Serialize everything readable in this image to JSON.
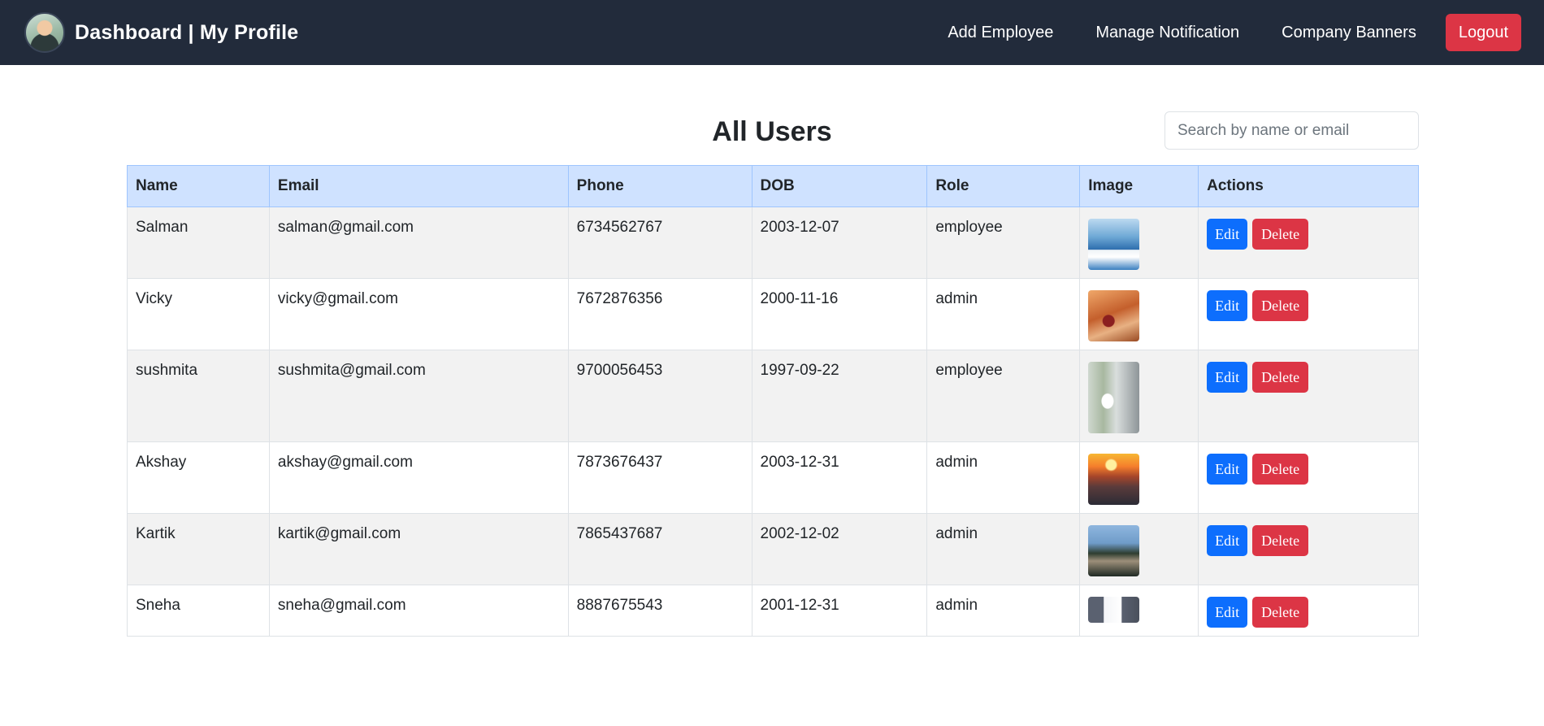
{
  "navbar": {
    "title": "Dashboard | My Profile",
    "links": [
      "Add Employee",
      "Manage Notification",
      "Company Banners"
    ],
    "logout_label": "Logout"
  },
  "page": {
    "title": "All Users",
    "search_placeholder": "Search by name or email"
  },
  "table": {
    "headers": [
      "Name",
      "Email",
      "Phone",
      "DOB",
      "Role",
      "Image",
      "Actions"
    ],
    "rows": [
      {
        "name": "Salman",
        "email": "salman@gmail.com",
        "phone": "6734562767",
        "dob": "2003-12-07",
        "role": "employee",
        "image": "thumb-sea"
      },
      {
        "name": "Vicky",
        "email": "vicky@gmail.com",
        "phone": "7672876356",
        "dob": "2000-11-16",
        "role": "admin",
        "image": "thumb-desert"
      },
      {
        "name": "sushmita",
        "email": "sushmita@gmail.com",
        "phone": "9700056453",
        "dob": "1997-09-22",
        "role": "employee",
        "image": "thumb-person"
      },
      {
        "name": "Akshay",
        "email": "akshay@gmail.com",
        "phone": "7873676437",
        "dob": "2003-12-31",
        "role": "admin",
        "image": "thumb-sunset"
      },
      {
        "name": "Kartik",
        "email": "kartik@gmail.com",
        "phone": "7865437687",
        "dob": "2002-12-02",
        "role": "admin",
        "image": "thumb-city"
      },
      {
        "name": "Sneha",
        "email": "sneha@gmail.com",
        "phone": "8887675543",
        "dob": "2001-12-31",
        "role": "admin",
        "image": "thumb-screen"
      }
    ],
    "edit_label": "Edit",
    "delete_label": "Delete"
  },
  "colors": {
    "navbar_bg": "#222b3b",
    "header_bg": "#cfe2ff",
    "edit_btn": "#0d6efd",
    "delete_btn": "#dc3545"
  }
}
